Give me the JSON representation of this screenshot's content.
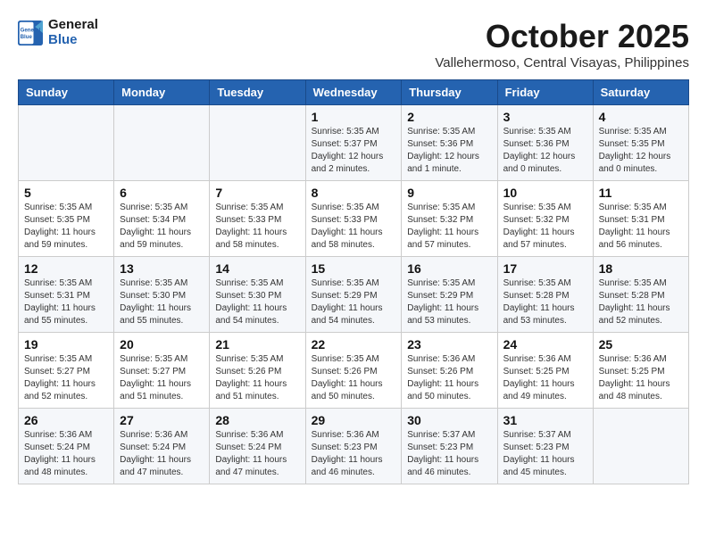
{
  "logo": {
    "line1": "General",
    "line2": "Blue"
  },
  "title": "October 2025",
  "location": "Vallehermoso, Central Visayas, Philippines",
  "days_of_week": [
    "Sunday",
    "Monday",
    "Tuesday",
    "Wednesday",
    "Thursday",
    "Friday",
    "Saturday"
  ],
  "weeks": [
    [
      {
        "day": "",
        "info": ""
      },
      {
        "day": "",
        "info": ""
      },
      {
        "day": "",
        "info": ""
      },
      {
        "day": "1",
        "info": "Sunrise: 5:35 AM\nSunset: 5:37 PM\nDaylight: 12 hours\nand 2 minutes."
      },
      {
        "day": "2",
        "info": "Sunrise: 5:35 AM\nSunset: 5:36 PM\nDaylight: 12 hours\nand 1 minute."
      },
      {
        "day": "3",
        "info": "Sunrise: 5:35 AM\nSunset: 5:36 PM\nDaylight: 12 hours\nand 0 minutes."
      },
      {
        "day": "4",
        "info": "Sunrise: 5:35 AM\nSunset: 5:35 PM\nDaylight: 12 hours\nand 0 minutes."
      }
    ],
    [
      {
        "day": "5",
        "info": "Sunrise: 5:35 AM\nSunset: 5:35 PM\nDaylight: 11 hours\nand 59 minutes."
      },
      {
        "day": "6",
        "info": "Sunrise: 5:35 AM\nSunset: 5:34 PM\nDaylight: 11 hours\nand 59 minutes."
      },
      {
        "day": "7",
        "info": "Sunrise: 5:35 AM\nSunset: 5:33 PM\nDaylight: 11 hours\nand 58 minutes."
      },
      {
        "day": "8",
        "info": "Sunrise: 5:35 AM\nSunset: 5:33 PM\nDaylight: 11 hours\nand 58 minutes."
      },
      {
        "day": "9",
        "info": "Sunrise: 5:35 AM\nSunset: 5:32 PM\nDaylight: 11 hours\nand 57 minutes."
      },
      {
        "day": "10",
        "info": "Sunrise: 5:35 AM\nSunset: 5:32 PM\nDaylight: 11 hours\nand 57 minutes."
      },
      {
        "day": "11",
        "info": "Sunrise: 5:35 AM\nSunset: 5:31 PM\nDaylight: 11 hours\nand 56 minutes."
      }
    ],
    [
      {
        "day": "12",
        "info": "Sunrise: 5:35 AM\nSunset: 5:31 PM\nDaylight: 11 hours\nand 55 minutes."
      },
      {
        "day": "13",
        "info": "Sunrise: 5:35 AM\nSunset: 5:30 PM\nDaylight: 11 hours\nand 55 minutes."
      },
      {
        "day": "14",
        "info": "Sunrise: 5:35 AM\nSunset: 5:30 PM\nDaylight: 11 hours\nand 54 minutes."
      },
      {
        "day": "15",
        "info": "Sunrise: 5:35 AM\nSunset: 5:29 PM\nDaylight: 11 hours\nand 54 minutes."
      },
      {
        "day": "16",
        "info": "Sunrise: 5:35 AM\nSunset: 5:29 PM\nDaylight: 11 hours\nand 53 minutes."
      },
      {
        "day": "17",
        "info": "Sunrise: 5:35 AM\nSunset: 5:28 PM\nDaylight: 11 hours\nand 53 minutes."
      },
      {
        "day": "18",
        "info": "Sunrise: 5:35 AM\nSunset: 5:28 PM\nDaylight: 11 hours\nand 52 minutes."
      }
    ],
    [
      {
        "day": "19",
        "info": "Sunrise: 5:35 AM\nSunset: 5:27 PM\nDaylight: 11 hours\nand 52 minutes."
      },
      {
        "day": "20",
        "info": "Sunrise: 5:35 AM\nSunset: 5:27 PM\nDaylight: 11 hours\nand 51 minutes."
      },
      {
        "day": "21",
        "info": "Sunrise: 5:35 AM\nSunset: 5:26 PM\nDaylight: 11 hours\nand 51 minutes."
      },
      {
        "day": "22",
        "info": "Sunrise: 5:35 AM\nSunset: 5:26 PM\nDaylight: 11 hours\nand 50 minutes."
      },
      {
        "day": "23",
        "info": "Sunrise: 5:36 AM\nSunset: 5:26 PM\nDaylight: 11 hours\nand 50 minutes."
      },
      {
        "day": "24",
        "info": "Sunrise: 5:36 AM\nSunset: 5:25 PM\nDaylight: 11 hours\nand 49 minutes."
      },
      {
        "day": "25",
        "info": "Sunrise: 5:36 AM\nSunset: 5:25 PM\nDaylight: 11 hours\nand 48 minutes."
      }
    ],
    [
      {
        "day": "26",
        "info": "Sunrise: 5:36 AM\nSunset: 5:24 PM\nDaylight: 11 hours\nand 48 minutes."
      },
      {
        "day": "27",
        "info": "Sunrise: 5:36 AM\nSunset: 5:24 PM\nDaylight: 11 hours\nand 47 minutes."
      },
      {
        "day": "28",
        "info": "Sunrise: 5:36 AM\nSunset: 5:24 PM\nDaylight: 11 hours\nand 47 minutes."
      },
      {
        "day": "29",
        "info": "Sunrise: 5:36 AM\nSunset: 5:23 PM\nDaylight: 11 hours\nand 46 minutes."
      },
      {
        "day": "30",
        "info": "Sunrise: 5:37 AM\nSunset: 5:23 PM\nDaylight: 11 hours\nand 46 minutes."
      },
      {
        "day": "31",
        "info": "Sunrise: 5:37 AM\nSunset: 5:23 PM\nDaylight: 11 hours\nand 45 minutes."
      },
      {
        "day": "",
        "info": ""
      }
    ]
  ]
}
